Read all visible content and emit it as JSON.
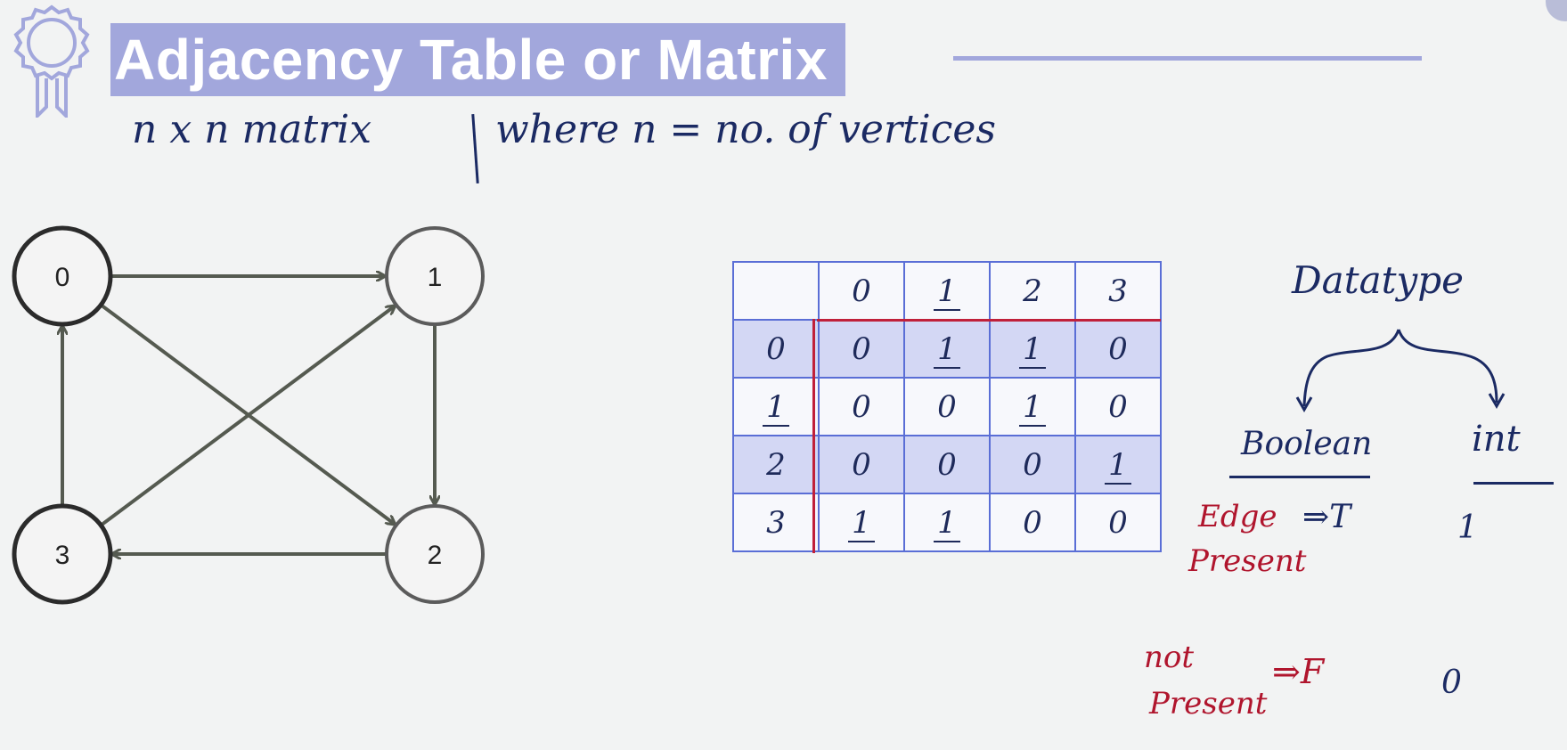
{
  "slide": {
    "title": "Adjacency Table or Matrix",
    "subtitle_left": "n x n  matrix",
    "subtitle_right": "where n = no. of vertices"
  },
  "graph": {
    "nodes": [
      {
        "id": "0",
        "label": "0"
      },
      {
        "id": "1",
        "label": "1"
      },
      {
        "id": "2",
        "label": "2"
      },
      {
        "id": "3",
        "label": "3"
      }
    ],
    "edges": [
      {
        "from": "0",
        "to": "1"
      },
      {
        "from": "0",
        "to": "2"
      },
      {
        "from": "1",
        "to": "2"
      },
      {
        "from": "2",
        "to": "3"
      },
      {
        "from": "3",
        "to": "0"
      },
      {
        "from": "3",
        "to": "1"
      }
    ]
  },
  "matrix": {
    "column_headers": [
      "0",
      "1",
      "2",
      "3"
    ],
    "rows": [
      {
        "header": "0",
        "cells": [
          "0",
          "1",
          "1",
          "0"
        ]
      },
      {
        "header": "1",
        "cells": [
          "0",
          "0",
          "1",
          "0"
        ]
      },
      {
        "header": "2",
        "cells": [
          "0",
          "0",
          "0",
          "1"
        ]
      },
      {
        "header": "3",
        "cells": [
          "1",
          "1",
          "0",
          "0"
        ]
      }
    ]
  },
  "datatype": {
    "heading": "Datatype",
    "boolean_label": "Boolean",
    "int_label": "int",
    "edge_present_label_1": "Edge",
    "edge_present_label_2": "Present",
    "edge_present_bool": "⇒T",
    "edge_present_int": "1",
    "not_present_label_1": "not",
    "not_present_label_2": "Present",
    "not_present_bool": "⇒F",
    "not_present_int": "0"
  },
  "colors": {
    "title_bg": "#a2a7dc",
    "ink_blue": "#1b2a63",
    "ink_red": "#b0152d",
    "table_border": "#5a6ed6",
    "table_shade": "#d3d7f4"
  }
}
